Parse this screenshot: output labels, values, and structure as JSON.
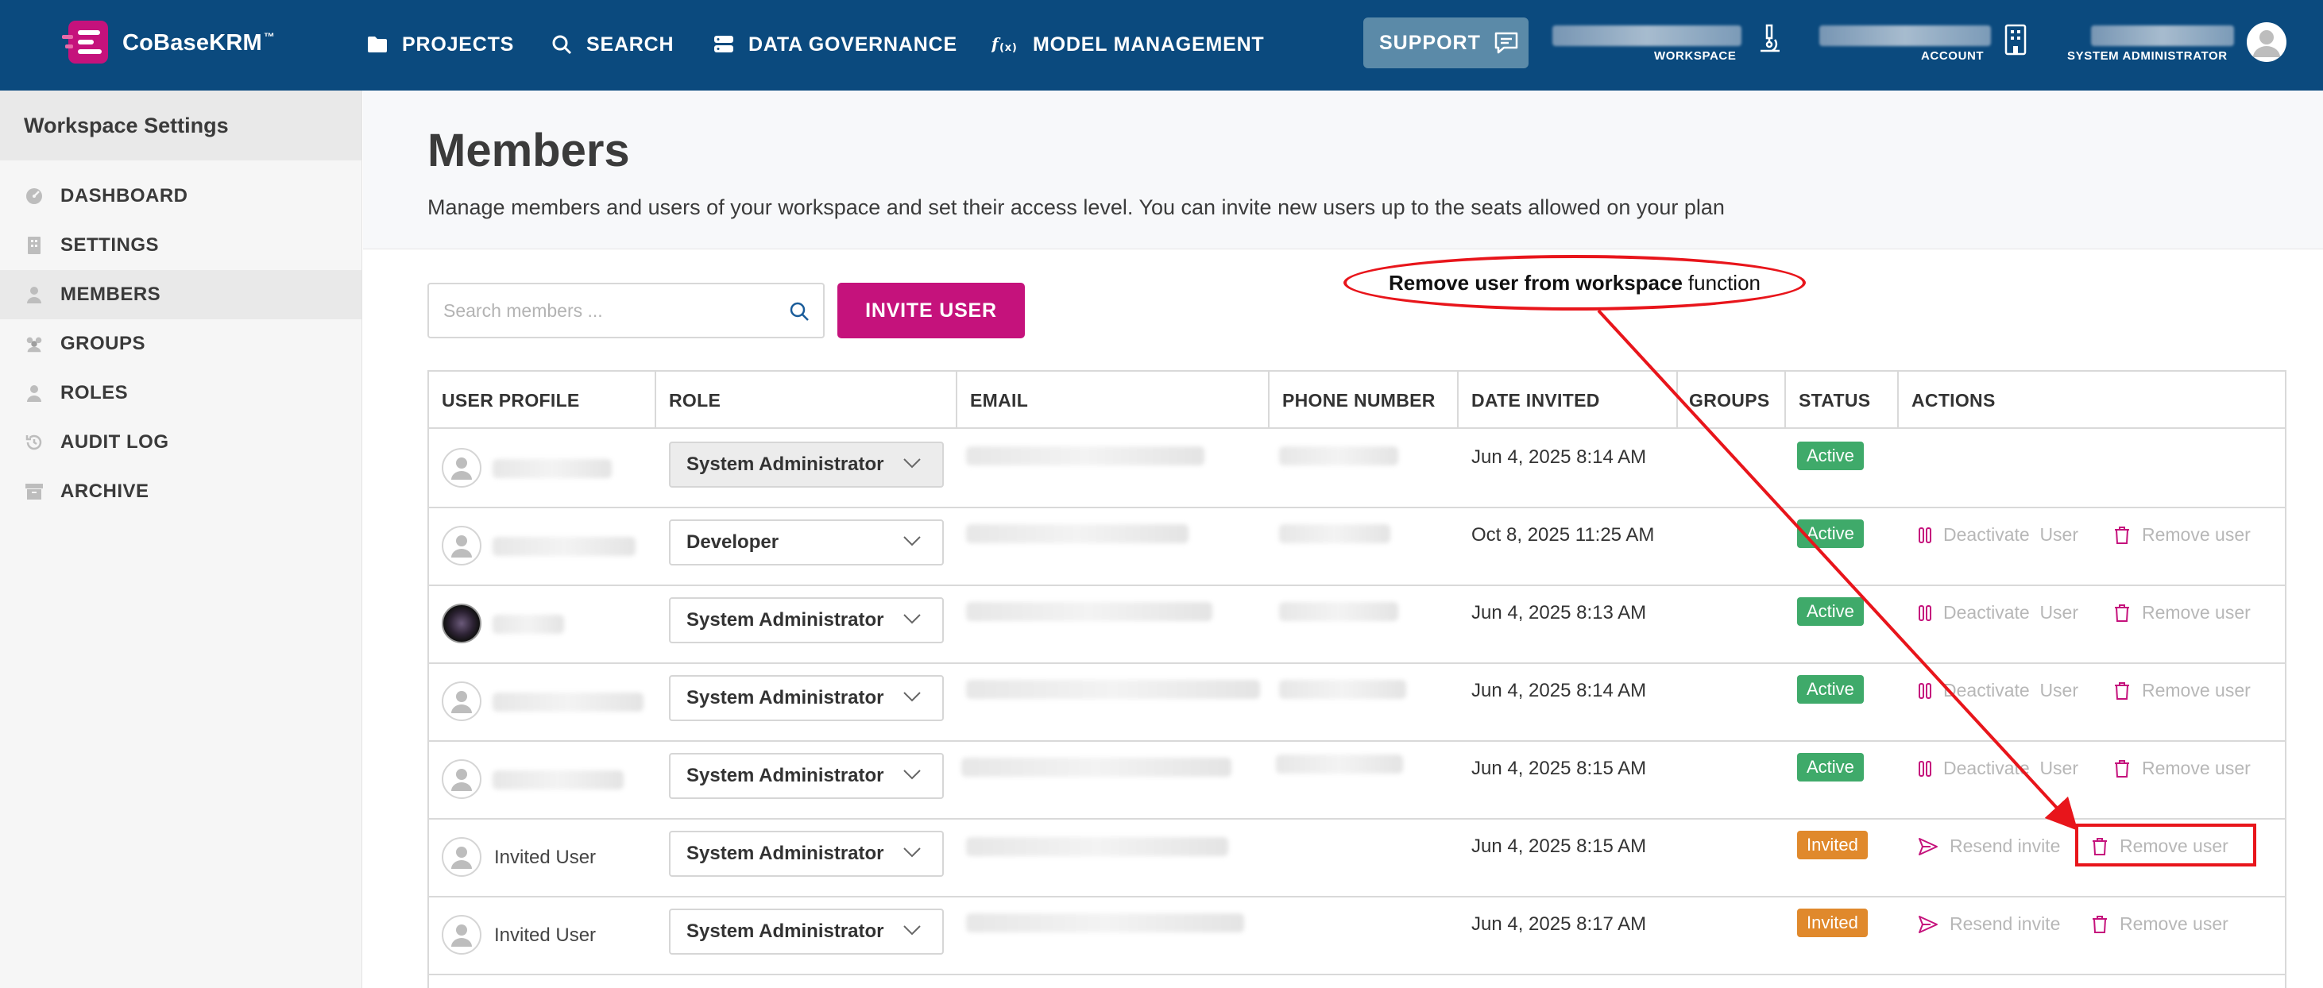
{
  "app": {
    "name": "CoBaseKRM",
    "trademark": "™"
  },
  "nav": {
    "items": [
      {
        "label": "PROJECTS",
        "icon": "folder-icon"
      },
      {
        "label": "SEARCH",
        "icon": "search-icon"
      },
      {
        "label": "DATA GOVERNANCE",
        "icon": "database-icon"
      },
      {
        "label": "MODEL MANAGEMENT",
        "icon": "function-icon"
      }
    ],
    "support_label": "SUPPORT",
    "workspace_label": "WORKSPACE",
    "account_label": "ACCOUNT",
    "user_role_label": "SYSTEM ADMINISTRATOR"
  },
  "sidebar": {
    "title": "Workspace Settings",
    "items": [
      {
        "label": "DASHBOARD",
        "icon": "dashboard-icon"
      },
      {
        "label": "SETTINGS",
        "icon": "building-icon"
      },
      {
        "label": "MEMBERS",
        "icon": "person-icon",
        "active": true
      },
      {
        "label": "GROUPS",
        "icon": "group-icon"
      },
      {
        "label": "ROLES",
        "icon": "role-icon"
      },
      {
        "label": "AUDIT LOG",
        "icon": "history-icon"
      },
      {
        "label": "ARCHIVE",
        "icon": "archive-icon"
      }
    ]
  },
  "page": {
    "title": "Members",
    "description": "Manage members and users of your workspace and set their access level. You can invite new users up to the seats allowed on your plan",
    "search_placeholder": "Search members ...",
    "invite_label": "INVITE USER"
  },
  "table": {
    "headers": [
      "USER PROFILE",
      "ROLE",
      "EMAIL",
      "PHONE NUMBER",
      "DATE INVITED",
      "GROUPS",
      "STATUS",
      "ACTIONS"
    ],
    "rows": [
      {
        "name": "",
        "role": "System Administrator",
        "date": "Jun 4, 2025 8:14 AM",
        "status": "Active",
        "actions": []
      },
      {
        "name": "",
        "role": "Developer",
        "date": "Oct 8, 2025 11:25 AM",
        "status": "Active",
        "actions": [
          "Deactivate  User",
          "Remove user"
        ]
      },
      {
        "name": "",
        "role": "System Administrator",
        "date": "Jun 4, 2025 8:13 AM",
        "status": "Active",
        "actions": [
          "Deactivate  User",
          "Remove user"
        ]
      },
      {
        "name": "",
        "role": "System Administrator",
        "date": "Jun 4, 2025 8:14 AM",
        "status": "Active",
        "actions": [
          "Deactivate  User",
          "Remove user"
        ]
      },
      {
        "name": "",
        "role": "System Administrator",
        "date": "Jun 4, 2025 8:15 AM",
        "status": "Active",
        "actions": [
          "Deactivate  User",
          "Remove user"
        ]
      },
      {
        "name": "Invited User",
        "role": "System Administrator",
        "date": "Jun 4, 2025 8:15 AM",
        "status": "Invited",
        "actions": [
          "Resend invite",
          "Remove user"
        ]
      },
      {
        "name": "Invited User",
        "role": "System Administrator",
        "date": "Jun 4, 2025 8:17 AM",
        "status": "Invited",
        "actions": [
          "Resend invite",
          "Remove user"
        ]
      }
    ]
  },
  "annotation": {
    "bold": "Remove user from workspace",
    "rest": "function"
  },
  "colors": {
    "topbar": "#0b4a7e",
    "accent": "#c5127c",
    "active_badge": "#3faa6a",
    "invited_badge": "#e0892c",
    "annotation_red": "#e8151b"
  }
}
